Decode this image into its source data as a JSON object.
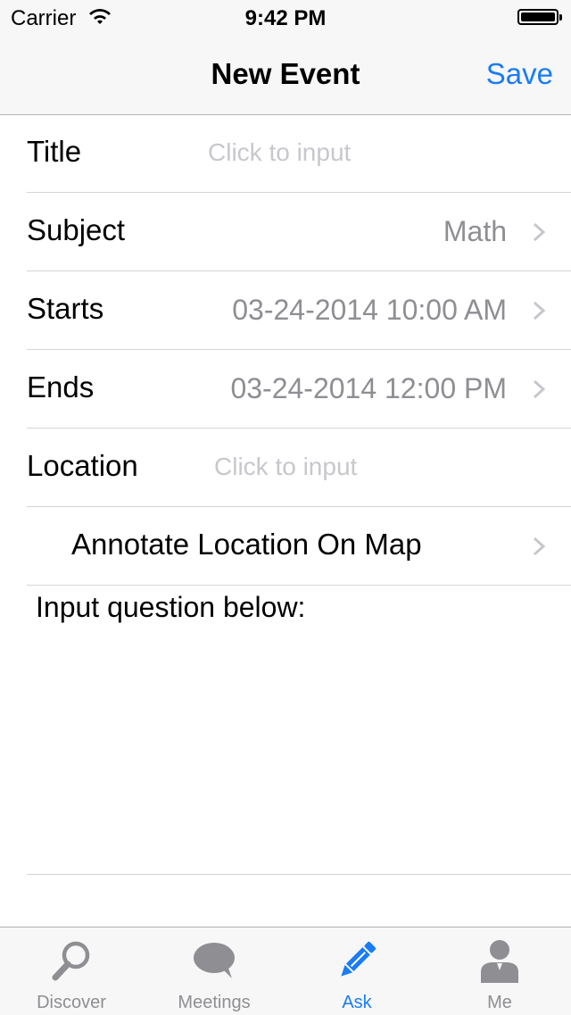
{
  "status_bar": {
    "carrier": "Carrier",
    "time": "9:42 PM"
  },
  "nav": {
    "title": "New Event",
    "save_label": "Save"
  },
  "form": {
    "title": {
      "label": "Title",
      "placeholder": "Click to input"
    },
    "subject": {
      "label": "Subject",
      "value": "Math"
    },
    "starts": {
      "label": "Starts",
      "value": "03-24-2014 10:00 AM"
    },
    "ends": {
      "label": "Ends",
      "value": "03-24-2014 12:00 PM"
    },
    "location": {
      "label": "Location",
      "placeholder": "Click to input"
    },
    "annotate": {
      "label": "Annotate Location On Map"
    },
    "question": {
      "label": "Input question below:"
    }
  },
  "tabbar": {
    "tabs": [
      {
        "label": "Discover",
        "icon": "magnifier-icon",
        "active": false
      },
      {
        "label": "Meetings",
        "icon": "chat-bubble-icon",
        "active": false
      },
      {
        "label": "Ask",
        "icon": "pencil-icon",
        "active": true
      },
      {
        "label": "Me",
        "icon": "person-icon",
        "active": false
      }
    ]
  },
  "colors": {
    "accent": "#1a7cf5",
    "secondary_text": "#8e8e93",
    "placeholder": "#c7c7cd",
    "icon_gray": "#8e8e93"
  }
}
